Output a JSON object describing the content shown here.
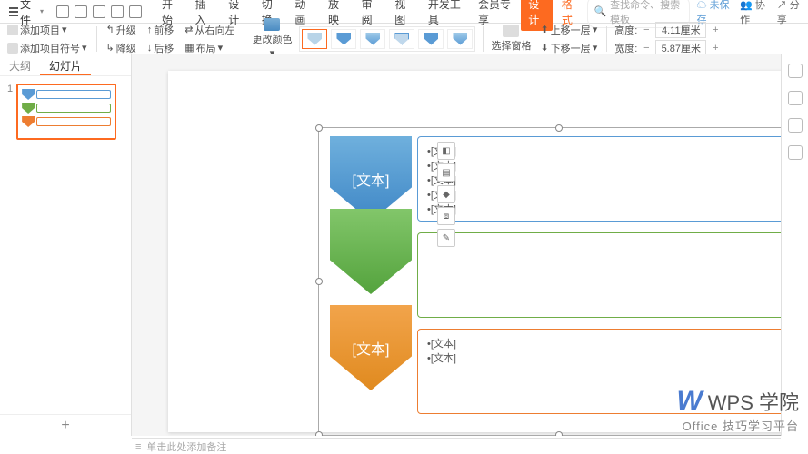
{
  "menu": {
    "file": "文件",
    "arrow": "▾"
  },
  "tabs": [
    "开始",
    "插入",
    "设计",
    "切换",
    "动画",
    "放映",
    "审阅",
    "视图",
    "开发工具",
    "会员专享",
    "设计",
    "格式"
  ],
  "top_right": {
    "search_placeholder": "查找命令、搜索模板",
    "unsaved": "未保存",
    "collab": "协作",
    "share": "分享"
  },
  "ribbon": {
    "add_item": "添加项目",
    "add_bullet": "添加项目符号",
    "promote": "升级",
    "demote": "降级",
    "prev": "前移",
    "next": "后移",
    "rtl": "从右向左",
    "layout": "布局",
    "more_color": "更改颜色",
    "select_pane": "选择窗格",
    "up_layer": "上移一层",
    "down_layer": "下移一层",
    "height_lbl": "高度:",
    "width_lbl": "宽度:",
    "height_val": "4.11厘米",
    "width_val": "5.87厘米"
  },
  "pane": {
    "outline": "大纲",
    "slides": "幻灯片"
  },
  "slide_num": "1",
  "smart": {
    "text_ph": "[文本]",
    "bullet": "•[文本]"
  },
  "notes": "单击此处添加备注",
  "watermark": {
    "brand": "WPS 学院",
    "sub": "Office 技巧学习平台"
  }
}
